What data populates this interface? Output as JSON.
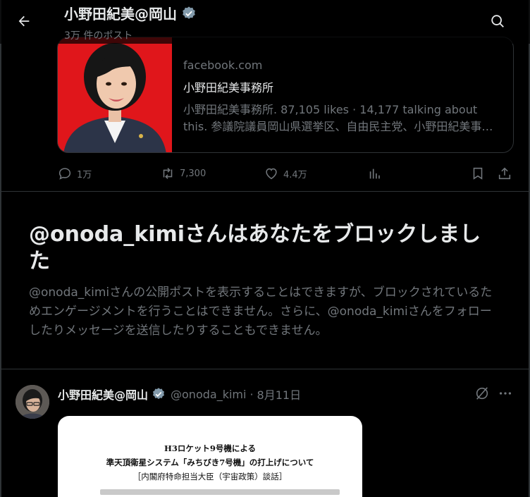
{
  "header": {
    "title": "小野田紀美@岡山",
    "post_count": "3万 件のポスト"
  },
  "link_card": {
    "domain": "facebook.com",
    "title": "小野田紀美事務所",
    "description": "小野田紀美事務所. 87,105 likes · 14,177 talking about this. 参議院議員岡山県選挙区、自由民主党、小野田紀美事務所の公式ページです。"
  },
  "actions": {
    "replies": "1万",
    "reposts": "7,300",
    "likes": "4.4万"
  },
  "blocked": {
    "title": "@onoda_kimiさんはあなたをブロックしました",
    "message": "@onoda_kimiさんの公開ポストを表示することはできますが、ブロックされているためエンゲージメントを行うことはできません。さらに、@onoda_kimiさんをフォローしたりメッセージを送信したりすることもできません。"
  },
  "post": {
    "name": "小野田紀美@岡山",
    "handle": "@onoda_kimi",
    "separator": "·",
    "date": "8月11日"
  },
  "document": {
    "line1": "H3ロケット9号機による",
    "line2": "準天頂衛星システム「みちびき7号機」の打上げについて",
    "line3": "［内閣府特命担当大臣（宇宙政策）談話］"
  },
  "colors": {
    "background": "#000000",
    "text_primary": "#e7e9ea",
    "text_secondary": "#71767b",
    "border": "#2f3336",
    "verified_badge": "#829aab",
    "card_thumb_bg": "#e0161b"
  }
}
